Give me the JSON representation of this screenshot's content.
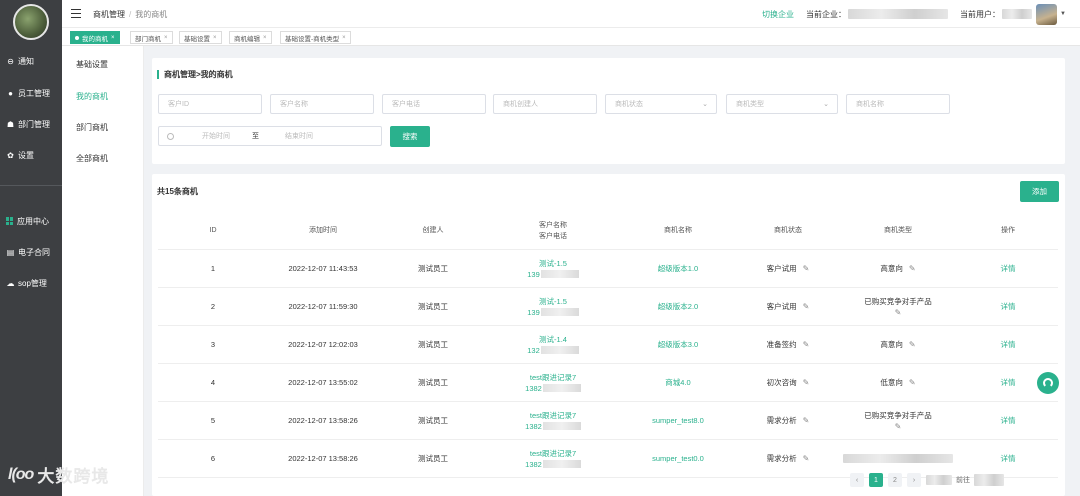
{
  "sidebar": {
    "items": [
      {
        "label": "通知",
        "icon": "minus-circle-icon"
      },
      {
        "label": "员工管理",
        "icon": "user-icon"
      },
      {
        "label": "部门管理",
        "icon": "org-chart-icon"
      },
      {
        "label": "设置",
        "icon": "gear-icon"
      },
      {
        "label": "应用中心",
        "icon": "apps-grid-icon"
      },
      {
        "label": "电子合同",
        "icon": "contract-icon"
      },
      {
        "label": "sop管理",
        "icon": "cloud-icon"
      }
    ]
  },
  "header": {
    "breadcrumb": [
      "商机管理",
      "我的商机"
    ],
    "breadcrumb_sep": "/",
    "switch_company": "切换企业",
    "current_company_label": "当前企业：",
    "current_user_label": "当前用户："
  },
  "tabs": [
    {
      "label": "我的商机",
      "active": true
    },
    {
      "label": "部门商机"
    },
    {
      "label": "基础设置"
    },
    {
      "label": "商机编辑"
    },
    {
      "label": "基础设置-商机类型"
    }
  ],
  "tab_close": "×",
  "submenu": [
    "基础设置",
    "我的商机",
    "部门商机",
    "全部商机"
  ],
  "search": {
    "title": "商机管理>我的商机",
    "fields": [
      "客户ID",
      "客户名称",
      "客户电话",
      "商机创建人",
      "商机状态",
      "商机类型",
      "商机名称"
    ],
    "date_start": "开始时间",
    "date_to": "至",
    "date_end": "结束时间",
    "search_button": "搜索"
  },
  "list": {
    "count_text": "共15条商机",
    "add_button": "添加",
    "columns": [
      "ID",
      "添加时间",
      "创建人",
      "客户名称",
      "客户电话",
      "商机名称",
      "商机状态",
      "商机类型",
      "操作"
    ],
    "rows": [
      {
        "id": "1",
        "time": "2022-12-07 11:43:53",
        "creator": "测试员工",
        "customer": "测试-1.5",
        "phone": "139",
        "name": "超级版本1.0",
        "status": "客户试用",
        "type": "高意向",
        "action": "详情"
      },
      {
        "id": "2",
        "time": "2022-12-07 11:59:30",
        "creator": "测试员工",
        "customer": "测试-1.5",
        "phone": "139",
        "name": "超级版本2.0",
        "status": "客户试用",
        "type": "已购买竞争对手产品",
        "action": "详情"
      },
      {
        "id": "3",
        "time": "2022-12-07 12:02:03",
        "creator": "测试员工",
        "customer": "测试-1.4",
        "phone": "132",
        "name": "超级版本3.0",
        "status": "准备签约",
        "type": "高意向",
        "action": "详情"
      },
      {
        "id": "4",
        "time": "2022-12-07 13:55:02",
        "creator": "测试员工",
        "customer": "test跟进记录7",
        "phone": "1382",
        "name": "商城4.0",
        "status": "初次咨询",
        "type": "低意向",
        "action": "详情"
      },
      {
        "id": "5",
        "time": "2022-12-07 13:58:26",
        "creator": "测试员工",
        "customer": "test跟进记录7",
        "phone": "1382",
        "name": "sumper_test8.0",
        "status": "需求分析",
        "type": "已购买竞争对手产品",
        "action": "详情"
      },
      {
        "id": "6",
        "time": "2022-12-07 13:58:26",
        "creator": "测试员工",
        "customer": "test跟进记录7",
        "phone": "1382",
        "name": "sumper_test0.0",
        "status": "需求分析",
        "type": "",
        "action": "详情"
      }
    ]
  },
  "pagination": {
    "prev": "‹",
    "current": "1",
    "page2": "2",
    "next": "›",
    "goto_label": "前往"
  },
  "watermark": {
    "mark": "l(oo",
    "text": "大数跨境"
  },
  "colors": {
    "accent": "#2ab18d",
    "sidebar_bg": "#3d3f42",
    "page_bg": "#f0f2f5"
  }
}
